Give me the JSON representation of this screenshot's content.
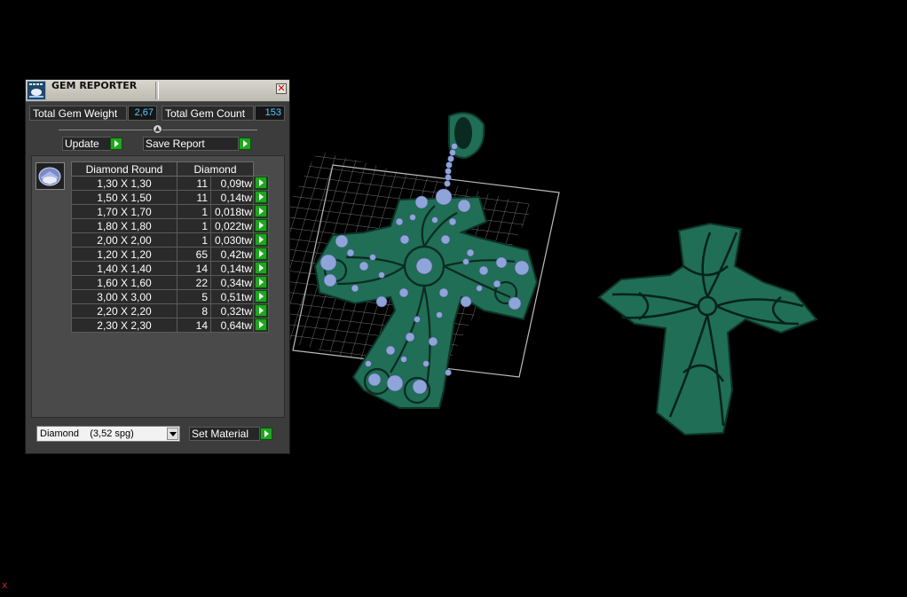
{
  "panel": {
    "title": "GEM REPORTER",
    "close_glyph": "✕",
    "total_gem_weight_label": "Total Gem Weight",
    "total_gem_weight_value": "2,67",
    "total_gem_count_label": "Total Gem Count",
    "total_gem_count_value": "153",
    "update_label": "Update",
    "save_report_label": "Save Report",
    "table": {
      "headers": [
        "Diamond Round",
        "Diamond"
      ],
      "rows": [
        {
          "size": "1,30 X 1,30",
          "count": "11",
          "weight": "0,09tw"
        },
        {
          "size": "1,50 X 1,50",
          "count": "11",
          "weight": "0,14tw"
        },
        {
          "size": "1,70 X 1,70",
          "count": "1",
          "weight": "0,018tw"
        },
        {
          "size": "1,80 X 1,80",
          "count": "1",
          "weight": "0,022tw"
        },
        {
          "size": "2,00 X 2,00",
          "count": "1",
          "weight": "0,030tw"
        },
        {
          "size": "1,20 X 1,20",
          "count": "65",
          "weight": "0,42tw"
        },
        {
          "size": "1,40 X 1,40",
          "count": "14",
          "weight": "0,14tw"
        },
        {
          "size": "1,60 X 1,60",
          "count": "22",
          "weight": "0,34tw"
        },
        {
          "size": "3,00 X 3,00",
          "count": "5",
          "weight": "0,51tw"
        },
        {
          "size": "2,20 X 2,20",
          "count": "8",
          "weight": "0,32tw"
        },
        {
          "size": "2,30 X 2,30",
          "count": "14",
          "weight": "0,64tw"
        }
      ]
    },
    "material_value": "Diamond    (3,52 spg)",
    "set_material_label": "Set Material"
  },
  "viewport": {
    "corner_mark": "x"
  },
  "colors": {
    "model_green": "#1f6e55",
    "gem_blue": "#8fa4d8",
    "go_button_green": "#1fa61f",
    "value_cyan": "#5ec8ff"
  },
  "icons": [
    "app-icon",
    "close-icon",
    "play-arrow-icon",
    "slider-knob-icon",
    "dropdown-arrow-icon",
    "gem-thumbnail-icon"
  ]
}
